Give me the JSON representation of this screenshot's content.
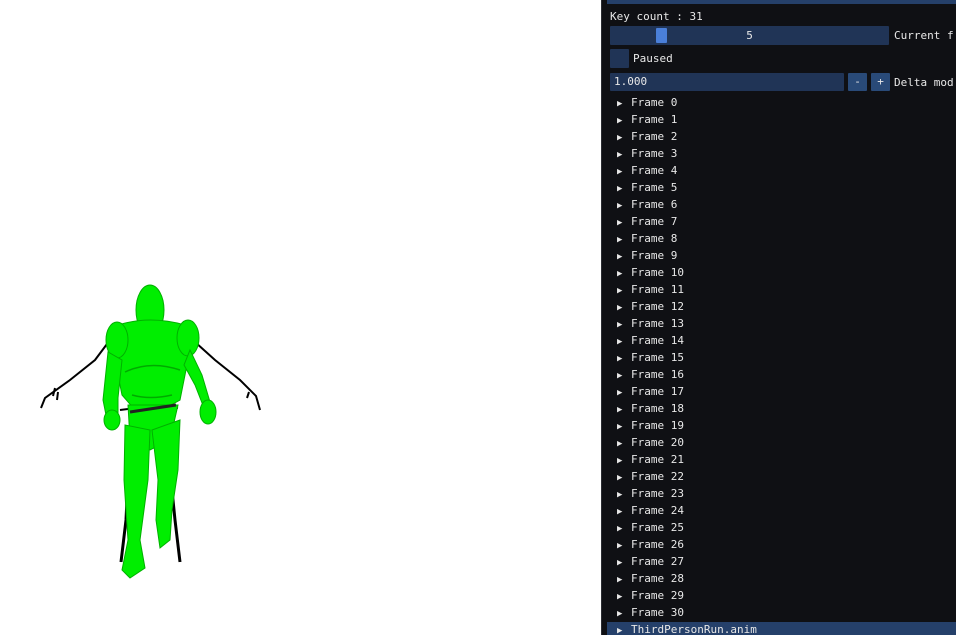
{
  "viewport": {
    "model_color": "#00ee00",
    "bone_color": "#000000"
  },
  "panel": {
    "key_count_label": "Key count : 31",
    "current_frame_value": "5",
    "current_frame_label": "Current f",
    "paused_label": "Paused",
    "delta_value": "1.000",
    "minus_label": "-",
    "plus_label": "+",
    "delta_label": "Delta mod",
    "frames": [
      "Frame 0",
      "Frame 1",
      "Frame 2",
      "Frame 3",
      "Frame 4",
      "Frame 5",
      "Frame 6",
      "Frame 7",
      "Frame 8",
      "Frame 9",
      "Frame 10",
      "Frame 11",
      "Frame 12",
      "Frame 13",
      "Frame 14",
      "Frame 15",
      "Frame 16",
      "Frame 17",
      "Frame 18",
      "Frame 19",
      "Frame 20",
      "Frame 21",
      "Frame 22",
      "Frame 23",
      "Frame 24",
      "Frame 25",
      "Frame 26",
      "Frame 27",
      "Frame 28",
      "Frame 29",
      "Frame 30"
    ],
    "anim_file": "ThirdPersonRun.anim",
    "accent_color": "#4a7fd9",
    "frame_bg_color": "#203456"
  }
}
